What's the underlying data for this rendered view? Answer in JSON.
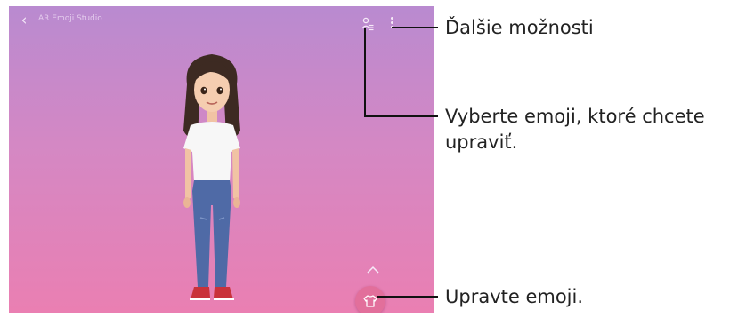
{
  "screen": {
    "title": "AR Emoji Studio",
    "icons": {
      "back": "back-arrow-icon",
      "switch_emoji": "person-list-icon",
      "more": "more-options-icon",
      "expand": "chevron-up-icon",
      "outfit": "t-shirt-icon"
    },
    "colors": {
      "background_top": "#b98ad0",
      "background_bottom": "#ea7fb2",
      "outfit_button": "#e26f9b"
    }
  },
  "callouts": {
    "more_options": "Ďalšie možnosti",
    "select_emoji_line1": "Vyberte emoji, ktoré chcete",
    "select_emoji_line2": "upraviť.",
    "edit_emoji": "Upravte emoji."
  }
}
